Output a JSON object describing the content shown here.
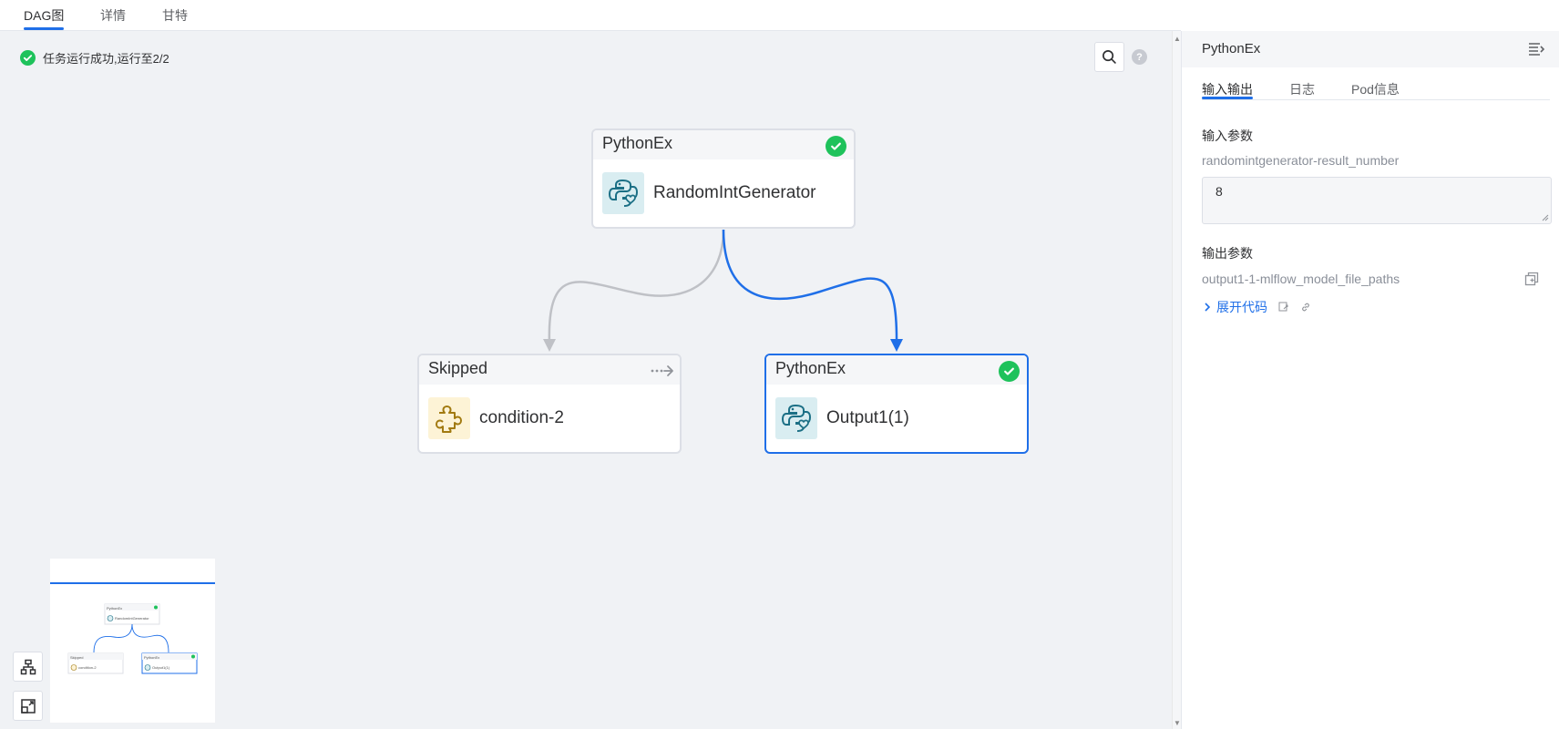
{
  "tabs": [
    {
      "label": "DAG图",
      "active": true
    },
    {
      "label": "详情",
      "active": false
    },
    {
      "label": "甘特",
      "active": false
    }
  ],
  "status": {
    "text": "任务运行成功,运行至2/2",
    "color": "#1ec25b"
  },
  "nodes": [
    {
      "header": "PythonEx",
      "name": "RandomIntGenerator",
      "status": "success",
      "icon": "python-icon"
    },
    {
      "header": "Skipped",
      "name": "condition-2",
      "status": "skipped",
      "icon": "puzzle-icon"
    },
    {
      "header": "PythonEx",
      "name": "Output1(1)",
      "status": "success",
      "icon": "python-icon",
      "selected": true
    }
  ],
  "minimap": {
    "nodes": [
      {
        "header": "PythonEx",
        "name": "RandomIntGenerator"
      },
      {
        "header": "Skipped",
        "name": "condition-2"
      },
      {
        "header": "PythonEx",
        "name": "Output1(1)"
      }
    ]
  },
  "panel": {
    "title": "PythonEx",
    "tabs": [
      {
        "label": "输入输出",
        "active": true
      },
      {
        "label": "日志",
        "active": false
      },
      {
        "label": "Pod信息",
        "active": false
      }
    ],
    "input_title": "输入参数",
    "input_param_name": "randomintgenerator-result_number",
    "input_param_value": "8",
    "output_title": "输出参数",
    "output_param_name": "output1-1-mlflow_model_file_paths",
    "expand_label": "展开代码"
  },
  "colors": {
    "accent": "#1f6fe8",
    "success": "#1ec25b",
    "edge_inactive": "#bfc1c6"
  }
}
